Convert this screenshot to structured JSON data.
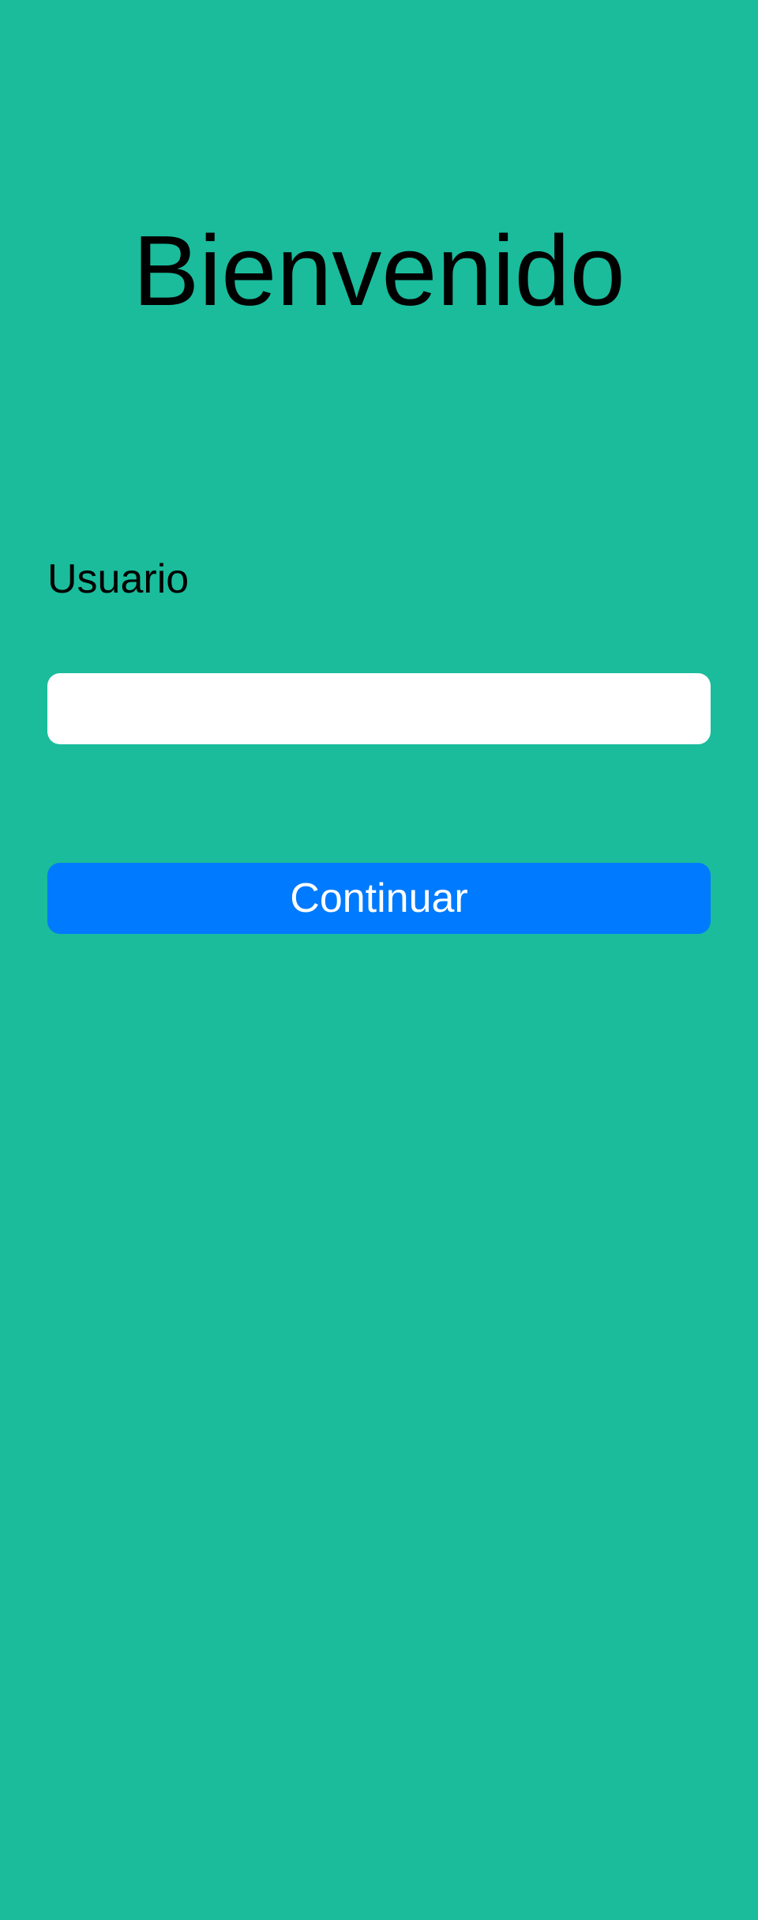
{
  "screen": {
    "background_color": "#1ABC9C"
  },
  "header": {
    "title": "Bienvenido"
  },
  "form": {
    "username_label": "Usuario",
    "username_value": "",
    "username_placeholder": "",
    "continue_label": "Continuar",
    "button_color": "#007AFF"
  }
}
